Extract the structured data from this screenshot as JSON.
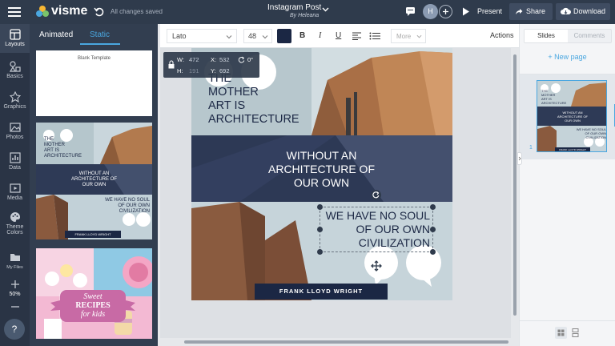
{
  "app": {
    "logo": "visme",
    "save_status": "All changes saved",
    "doc_title": "Instagram Post",
    "doc_author": "By Heleana",
    "avatar_initial": "H",
    "present_label": "Present",
    "share_label": "Share",
    "download_label": "Download"
  },
  "nav": {
    "layouts": "Layouts",
    "basics": "Basics",
    "graphics": "Graphics",
    "photos": "Photos",
    "data": "Data",
    "media": "Media",
    "theme_colors_1": "Theme",
    "theme_colors_2": "Colors",
    "my_files": "My Files",
    "zoom": "50%",
    "help": "?"
  },
  "templates": {
    "tab_animated": "Animated",
    "tab_static": "Static",
    "blank_label": "Blank Template",
    "t2_title_1": "THE",
    "t2_title_2": "MOTHER",
    "t2_title_3": "ART IS",
    "t2_title_4": "ARCHITECTURE",
    "t2_mid_1": "WITHOUT AN",
    "t2_mid_2": "ARCHITECTURE OF",
    "t2_mid_3": "OUR OWN",
    "t2_low_1": "WE HAVE NO SOUL",
    "t2_low_2": "OF OUR OWN",
    "t2_low_3": "CIVILIZATION",
    "t2_banner": "FRANK LLOYD WRIGHT",
    "t3_line1": "Sweet",
    "t3_line2": "RECIPES",
    "t3_line3": "for kids"
  },
  "toolbar": {
    "font": "Lato",
    "size": "48",
    "bold": "B",
    "italic": "I",
    "underline": "U",
    "more": "More",
    "actions": "Actions"
  },
  "selection": {
    "w_label": "W:",
    "w_value": "472",
    "h_label": "H:",
    "h_value": "191",
    "x_label": "X:",
    "x_value": "532",
    "y_label": "Y:",
    "y_value": "692",
    "rotation": "0°"
  },
  "post": {
    "title_1": "THE",
    "title_2": "MOTHER",
    "title_3": "ART IS",
    "title_4": "ARCHITECTURE",
    "mid_1": "WITHOUT AN",
    "mid_2": "ARCHITECTURE OF",
    "mid_3": "OUR OWN",
    "low_1": "WE HAVE NO SOUL",
    "low_2": "OF OUR OWN",
    "low_3": "CIVILIZATION",
    "banner": "FRANK LLOYD WRIGHT"
  },
  "right": {
    "tab_slides": "Slides",
    "tab_comments": "Comments",
    "new_page": "+ New page",
    "slide_number": "1",
    "s_title_1": "THE",
    "s_title_2": "MOTHER",
    "s_title_3": "ART IS",
    "s_title_4": "ARCHITECTURE",
    "s_mid_1": "WITHOUT AN",
    "s_mid_2": "ARCHITECTURE OF",
    "s_mid_3": "OUR OWN",
    "s_low_1": "WE HAVE NO SOUL",
    "s_low_2": "OF OUR OWN",
    "s_low_3": "CIVILIZATION",
    "s_banner": "FRANK LLOYD WRIGHT"
  },
  "colors": {
    "topbar": "#2f3b4c",
    "accent": "#4aa7e0",
    "navy": "#1b2744"
  }
}
